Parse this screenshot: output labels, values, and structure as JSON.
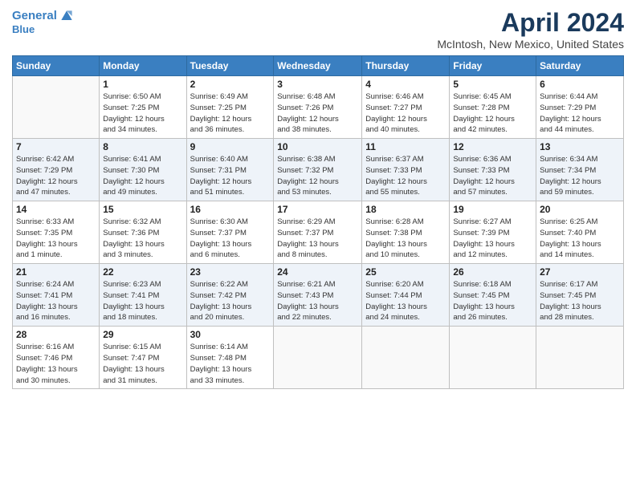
{
  "logo": {
    "line1": "General",
    "line2": "Blue"
  },
  "title": "April 2024",
  "subtitle": "McIntosh, New Mexico, United States",
  "weekdays": [
    "Sunday",
    "Monday",
    "Tuesday",
    "Wednesday",
    "Thursday",
    "Friday",
    "Saturday"
  ],
  "weeks": [
    [
      {
        "num": "",
        "info": ""
      },
      {
        "num": "1",
        "info": "Sunrise: 6:50 AM\nSunset: 7:25 PM\nDaylight: 12 hours\nand 34 minutes."
      },
      {
        "num": "2",
        "info": "Sunrise: 6:49 AM\nSunset: 7:25 PM\nDaylight: 12 hours\nand 36 minutes."
      },
      {
        "num": "3",
        "info": "Sunrise: 6:48 AM\nSunset: 7:26 PM\nDaylight: 12 hours\nand 38 minutes."
      },
      {
        "num": "4",
        "info": "Sunrise: 6:46 AM\nSunset: 7:27 PM\nDaylight: 12 hours\nand 40 minutes."
      },
      {
        "num": "5",
        "info": "Sunrise: 6:45 AM\nSunset: 7:28 PM\nDaylight: 12 hours\nand 42 minutes."
      },
      {
        "num": "6",
        "info": "Sunrise: 6:44 AM\nSunset: 7:29 PM\nDaylight: 12 hours\nand 44 minutes."
      }
    ],
    [
      {
        "num": "7",
        "info": "Sunrise: 6:42 AM\nSunset: 7:29 PM\nDaylight: 12 hours\nand 47 minutes."
      },
      {
        "num": "8",
        "info": "Sunrise: 6:41 AM\nSunset: 7:30 PM\nDaylight: 12 hours\nand 49 minutes."
      },
      {
        "num": "9",
        "info": "Sunrise: 6:40 AM\nSunset: 7:31 PM\nDaylight: 12 hours\nand 51 minutes."
      },
      {
        "num": "10",
        "info": "Sunrise: 6:38 AM\nSunset: 7:32 PM\nDaylight: 12 hours\nand 53 minutes."
      },
      {
        "num": "11",
        "info": "Sunrise: 6:37 AM\nSunset: 7:33 PM\nDaylight: 12 hours\nand 55 minutes."
      },
      {
        "num": "12",
        "info": "Sunrise: 6:36 AM\nSunset: 7:33 PM\nDaylight: 12 hours\nand 57 minutes."
      },
      {
        "num": "13",
        "info": "Sunrise: 6:34 AM\nSunset: 7:34 PM\nDaylight: 12 hours\nand 59 minutes."
      }
    ],
    [
      {
        "num": "14",
        "info": "Sunrise: 6:33 AM\nSunset: 7:35 PM\nDaylight: 13 hours\nand 1 minute."
      },
      {
        "num": "15",
        "info": "Sunrise: 6:32 AM\nSunset: 7:36 PM\nDaylight: 13 hours\nand 3 minutes."
      },
      {
        "num": "16",
        "info": "Sunrise: 6:30 AM\nSunset: 7:37 PM\nDaylight: 13 hours\nand 6 minutes."
      },
      {
        "num": "17",
        "info": "Sunrise: 6:29 AM\nSunset: 7:37 PM\nDaylight: 13 hours\nand 8 minutes."
      },
      {
        "num": "18",
        "info": "Sunrise: 6:28 AM\nSunset: 7:38 PM\nDaylight: 13 hours\nand 10 minutes."
      },
      {
        "num": "19",
        "info": "Sunrise: 6:27 AM\nSunset: 7:39 PM\nDaylight: 13 hours\nand 12 minutes."
      },
      {
        "num": "20",
        "info": "Sunrise: 6:25 AM\nSunset: 7:40 PM\nDaylight: 13 hours\nand 14 minutes."
      }
    ],
    [
      {
        "num": "21",
        "info": "Sunrise: 6:24 AM\nSunset: 7:41 PM\nDaylight: 13 hours\nand 16 minutes."
      },
      {
        "num": "22",
        "info": "Sunrise: 6:23 AM\nSunset: 7:41 PM\nDaylight: 13 hours\nand 18 minutes."
      },
      {
        "num": "23",
        "info": "Sunrise: 6:22 AM\nSunset: 7:42 PM\nDaylight: 13 hours\nand 20 minutes."
      },
      {
        "num": "24",
        "info": "Sunrise: 6:21 AM\nSunset: 7:43 PM\nDaylight: 13 hours\nand 22 minutes."
      },
      {
        "num": "25",
        "info": "Sunrise: 6:20 AM\nSunset: 7:44 PM\nDaylight: 13 hours\nand 24 minutes."
      },
      {
        "num": "26",
        "info": "Sunrise: 6:18 AM\nSunset: 7:45 PM\nDaylight: 13 hours\nand 26 minutes."
      },
      {
        "num": "27",
        "info": "Sunrise: 6:17 AM\nSunset: 7:45 PM\nDaylight: 13 hours\nand 28 minutes."
      }
    ],
    [
      {
        "num": "28",
        "info": "Sunrise: 6:16 AM\nSunset: 7:46 PM\nDaylight: 13 hours\nand 30 minutes."
      },
      {
        "num": "29",
        "info": "Sunrise: 6:15 AM\nSunset: 7:47 PM\nDaylight: 13 hours\nand 31 minutes."
      },
      {
        "num": "30",
        "info": "Sunrise: 6:14 AM\nSunset: 7:48 PM\nDaylight: 13 hours\nand 33 minutes."
      },
      {
        "num": "",
        "info": ""
      },
      {
        "num": "",
        "info": ""
      },
      {
        "num": "",
        "info": ""
      },
      {
        "num": "",
        "info": ""
      }
    ]
  ]
}
